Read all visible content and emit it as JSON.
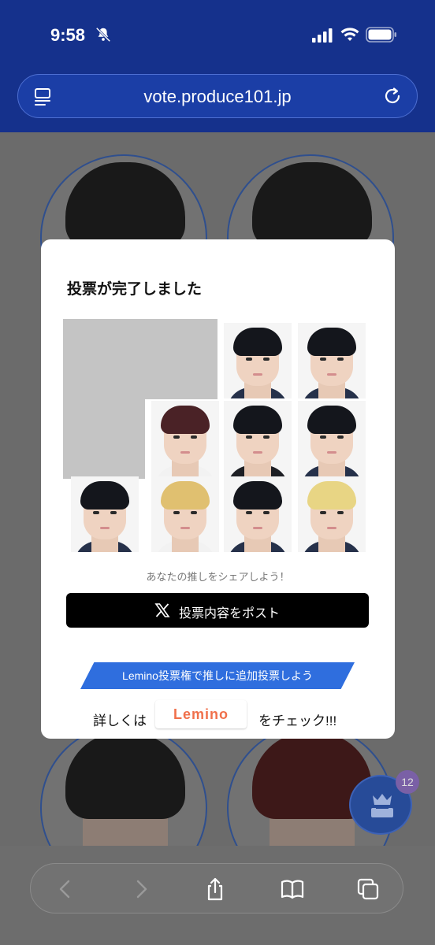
{
  "status": {
    "time": "9:58"
  },
  "browser": {
    "url": "vote.produce101.jp"
  },
  "modal": {
    "title": "投票が完了しました",
    "share_caption": "あなたの推しをシェアしよう！",
    "post_button_label": "投票内容をポスト",
    "lemino": {
      "banner": "Lemino投票権で推しに追加投票しよう",
      "prefix": "詳しくは",
      "logo": "Lemino",
      "suffix": "をチェック!!!"
    }
  },
  "vote_badge": {
    "count": "12"
  },
  "colors": {
    "nav_blue": "#15318c",
    "overlay_gray": "#6d6d6d",
    "lemino_orange": "#f0704b",
    "banner_blue": "#2f6ede"
  }
}
